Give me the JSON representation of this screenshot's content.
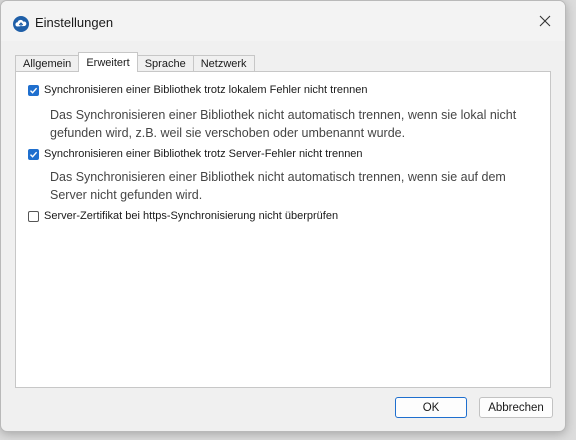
{
  "window": {
    "title": "Einstellungen",
    "icons": {
      "app": "seafile-cloud-icon",
      "close": "close-icon"
    }
  },
  "tabs": [
    {
      "label": "Allgemein",
      "active": false
    },
    {
      "label": "Erweitert",
      "active": true
    },
    {
      "label": "Sprache",
      "active": false
    },
    {
      "label": "Netzwerk",
      "active": false
    }
  ],
  "options": [
    {
      "label": "Synchronisieren einer Bibliothek trotz lokalem Fehler nicht trennen",
      "checked": true,
      "description": "Das Synchronisieren einer Bibliothek nicht automatisch trennen, wenn sie lokal nicht gefunden wird, z.B. weil sie verschoben oder umbenannt wurde."
    },
    {
      "label": "Synchronisieren einer Bibliothek trotz Server-Fehler nicht trennen",
      "checked": true,
      "description": "Das Synchronisieren einer Bibliothek nicht automatisch trennen, wenn sie auf dem Server nicht gefunden wird."
    },
    {
      "label": "Server-Zertifikat bei https-Synchronisierung nicht überprüfen",
      "checked": false,
      "description": ""
    }
  ],
  "buttons": {
    "ok": "OK",
    "cancel": "Abbrechen"
  },
  "colors": {
    "accent": "#1f6fce",
    "panel": "#ffffff",
    "window": "#f0f0f0"
  }
}
